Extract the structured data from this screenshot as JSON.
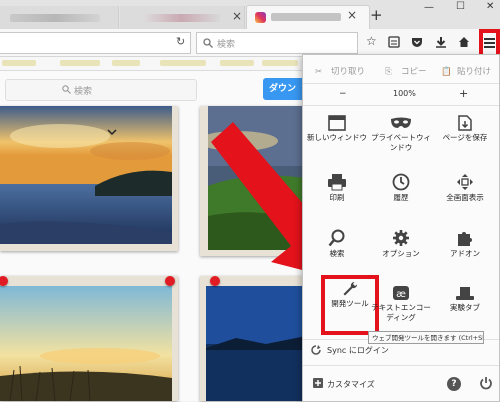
{
  "browser": {
    "new_tab_symbol": "+",
    "tab_close_symbol": "×",
    "window": {
      "minimize_symbol": "—",
      "maximize_symbol": "☐",
      "close_symbol": "✕"
    },
    "search_placeholder": "検索"
  },
  "page": {
    "search_placeholder": "検索",
    "download_button_label": "ダウン"
  },
  "menu": {
    "edit": {
      "cut": "切り取り",
      "copy": "コピー",
      "paste": "貼り付け"
    },
    "zoom": {
      "decrease": "−",
      "level": "100%",
      "increase": "+"
    },
    "tiles": [
      {
        "label": "新しいウィンドウ",
        "icon": "window-icon"
      },
      {
        "label": "プライベートウィンドウ",
        "icon": "mask-icon"
      },
      {
        "label": "ページを保存",
        "icon": "save-page-icon"
      },
      {
        "label": "印刷",
        "icon": "printer-icon"
      },
      {
        "label": "履歴",
        "icon": "history-icon"
      },
      {
        "label": "全画面表示",
        "icon": "fullscreen-icon"
      },
      {
        "label": "検索",
        "icon": "magnifier-icon"
      },
      {
        "label": "オプション",
        "icon": "gear-icon"
      },
      {
        "label": "アドオン",
        "icon": "puzzle-icon"
      },
      {
        "label": "開発ツール",
        "icon": "wrench-icon"
      },
      {
        "label": "テキストエンコーディング",
        "icon": "text-encoding-icon"
      },
      {
        "label": "実験タブ",
        "icon": "hat-icon"
      }
    ],
    "tooltip": "ウェブ開発ツールを開きます (Ctrl+Shift+I)",
    "sync_label": "Sync にログイン",
    "customize_label": "カスタマイズ"
  },
  "colors": {
    "highlight": "#e3121b",
    "arrow": "#e3121b",
    "accent": "#3897f0"
  }
}
